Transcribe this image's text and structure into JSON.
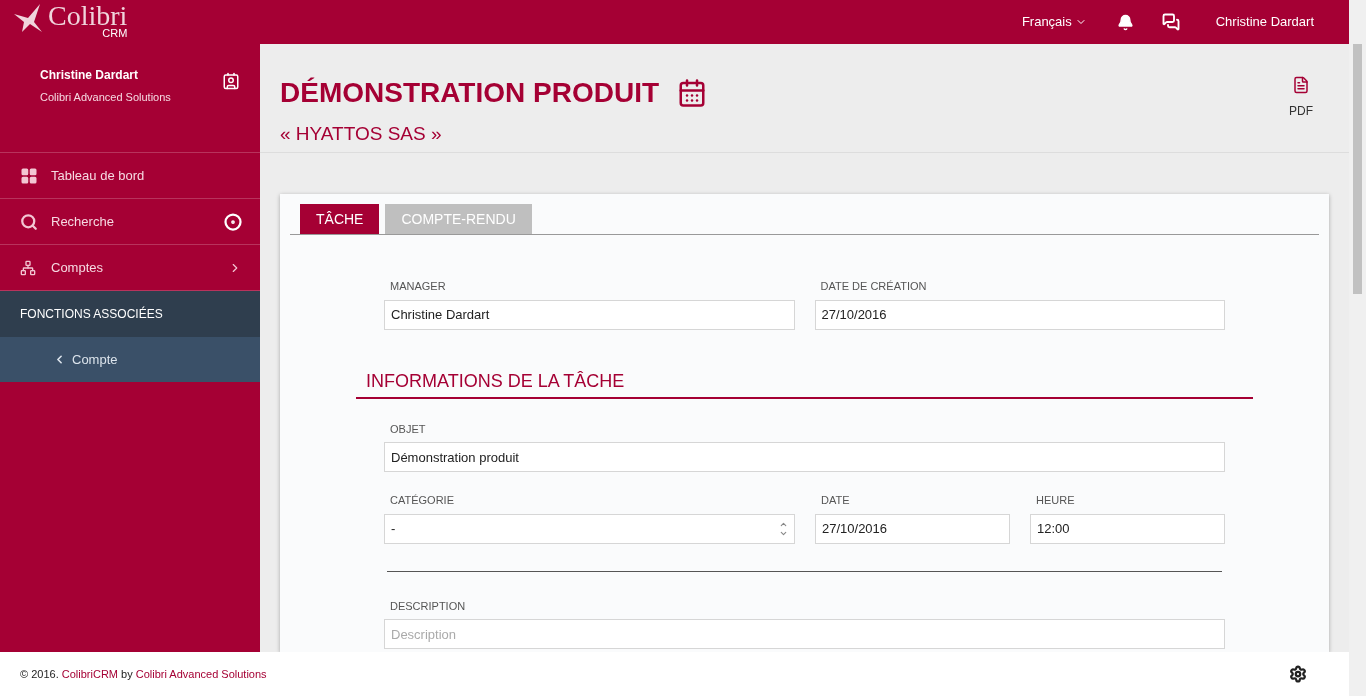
{
  "header": {
    "logo": "Colibri",
    "logo_sub": "CRM",
    "language": "Français",
    "user": "Christine Dardart"
  },
  "sidebar": {
    "user_name": "Christine Dardart",
    "company": "Colibri Advanced Solutions",
    "items": [
      {
        "kind": "dashboard",
        "label": "Tableau de bord"
      },
      {
        "kind": "search",
        "label": "Recherche"
      },
      {
        "kind": "accounts",
        "label": "Comptes"
      }
    ],
    "section": "FONCTIONS ASSOCIÉES",
    "sub_items": [
      {
        "label": "Compte"
      }
    ]
  },
  "page": {
    "title": "DÉMONSTRATION PRODUIT",
    "subtitle": "« HYATTOS SAS »",
    "pdf": "PDF"
  },
  "tabs": [
    {
      "label": "TÂCHE",
      "selected": true
    },
    {
      "label": "COMPTE-RENDU",
      "selected": false
    }
  ],
  "top_fields": [
    {
      "label": "MANAGER",
      "value": "Christine Dardart"
    },
    {
      "label": "DATE DE CRÉATION",
      "value": "27/10/2016"
    }
  ],
  "section_title": "INFORMATIONS DE LA TÂCHE",
  "object_field": {
    "label": "OBJET",
    "value": "Démonstration produit"
  },
  "detail_fields": [
    {
      "kind": "select",
      "label": "CATÉGORIE",
      "value": "-"
    },
    {
      "kind": "text",
      "label": "DATE",
      "value": "27/10/2016"
    },
    {
      "kind": "text",
      "label": "HEURE",
      "value": "12:00"
    }
  ],
  "description_field": {
    "label": "DESCRIPTION",
    "placeholder": "Description"
  },
  "footer": {
    "prefix": "© 2016.",
    "link": "ColibriCRM",
    "middle": "by",
    "company_link": "Colibri Advanced Solutions"
  }
}
